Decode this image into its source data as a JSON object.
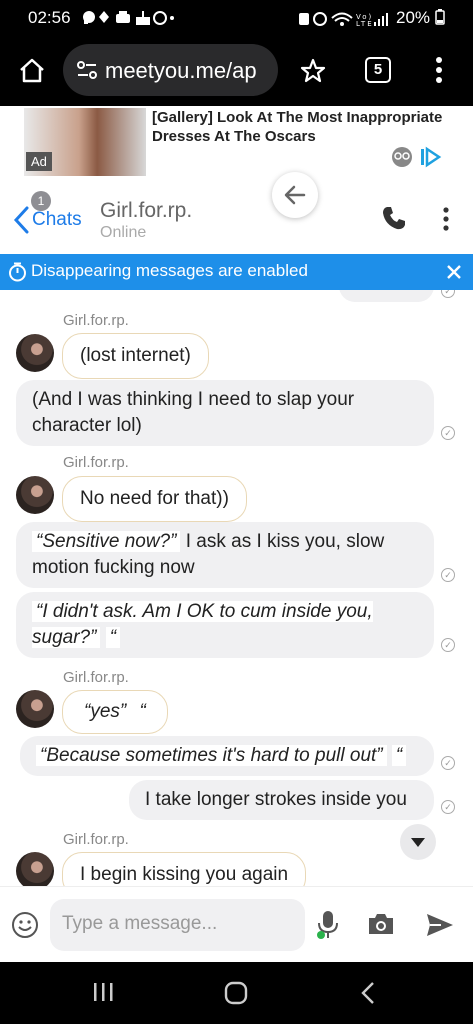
{
  "status_bar": {
    "time": "02:56",
    "left_icons": [
      "chat-icon",
      "pinwheel-icon",
      "print-icon",
      "cake-icon",
      "circle-icon",
      "dot-icon"
    ],
    "battery": "20%"
  },
  "browser": {
    "url": "meetyou.me/ap",
    "tab_count": "5"
  },
  "ad": {
    "tag": "Ad",
    "headline": "[Gallery] Look At The Most Inappropriate Dresses At The Oscars"
  },
  "chat_header": {
    "back_badge": "1",
    "back_label": "Chats",
    "contact_name": "Girl.for.rp.",
    "contact_status": "Online"
  },
  "banner": {
    "text": "Disappearing messages are enabled"
  },
  "messages": [
    {
      "sender": "Girl.for.rp.",
      "text": "(lost internet)"
    },
    {
      "text": "(And I was thinking I need to slap your character lol)"
    },
    {
      "sender": "Girl.for.rp.",
      "text": "No need for that))"
    },
    {
      "quote": "“Sensitive now?”",
      "text": " I ask as I kiss you, slow motion fucking now"
    },
    {
      "quote": "“I didn't ask. Am I OK to cum inside you, sugar?”",
      "tail": "“"
    },
    {
      "sender": "Girl.for.rp.",
      "quote": "“yes”",
      "tail": "“"
    },
    {
      "quote": "“Because sometimes it's hard to pull out”",
      "tail": "“"
    },
    {
      "text": "I take longer strokes inside you"
    },
    {
      "sender": "Girl.for.rp.",
      "text": "I begin kissing you again"
    }
  ],
  "input": {
    "placeholder": "Type a message..."
  },
  "colors": {
    "accent": "#1e8fe9",
    "link": "#1e7ce8",
    "bubble_border": "#e9d8b6",
    "bubble_gray": "#f0f0f2"
  }
}
